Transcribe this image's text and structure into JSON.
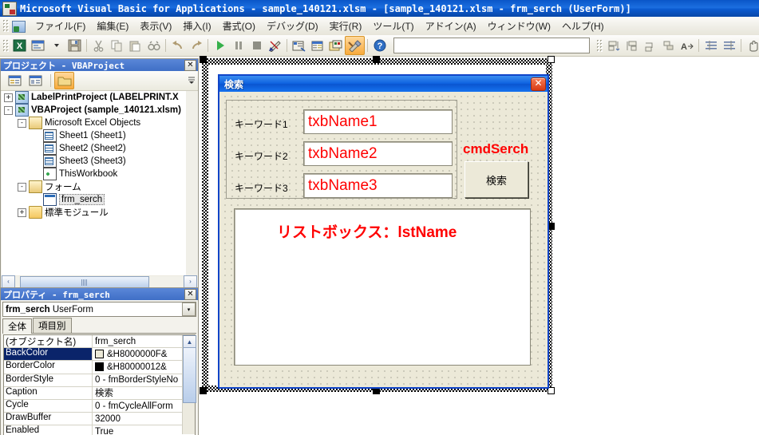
{
  "window": {
    "title": "Microsoft Visual Basic for Applications - sample_140121.xlsm - [sample_140121.xlsm - frm_serch (UserForm)]",
    "app_icon": "vba-icon"
  },
  "menu": {
    "items": [
      {
        "label": "ファイル(F)",
        "name": "menu-file"
      },
      {
        "label": "編集(E)",
        "name": "menu-edit"
      },
      {
        "label": "表示(V)",
        "name": "menu-view"
      },
      {
        "label": "挿入(I)",
        "name": "menu-insert"
      },
      {
        "label": "書式(O)",
        "name": "menu-format"
      },
      {
        "label": "デバッグ(D)",
        "name": "menu-debug"
      },
      {
        "label": "実行(R)",
        "name": "menu-run"
      },
      {
        "label": "ツール(T)",
        "name": "menu-tools"
      },
      {
        "label": "アドイン(A)",
        "name": "menu-addins"
      },
      {
        "label": "ウィンドウ(W)",
        "name": "menu-window"
      },
      {
        "label": "ヘルプ(H)",
        "name": "menu-help"
      }
    ]
  },
  "toolbar": {
    "buttons": [
      {
        "name": "view-excel-button",
        "glyph": "excel-icon",
        "selected": false
      },
      {
        "name": "insert-userform-button",
        "glyph": "userform-icon",
        "selected": false
      },
      {
        "name": "insert-dropdown-button",
        "glyph": "chevron-down-icon",
        "selected": false
      },
      {
        "name": "save-button",
        "glyph": "save-icon",
        "selected": false
      },
      {
        "name": "cut-button",
        "glyph": "scissors-icon",
        "selected": false
      },
      {
        "name": "copy-button",
        "glyph": "copy-icon",
        "selected": false
      },
      {
        "name": "paste-button",
        "glyph": "paste-icon",
        "selected": false
      },
      {
        "name": "find-button",
        "glyph": "binoculars-icon",
        "selected": false
      },
      {
        "name": "undo-button",
        "glyph": "undo-arrow-icon",
        "selected": false
      },
      {
        "name": "redo-button",
        "glyph": "redo-arrow-icon",
        "selected": false
      },
      {
        "name": "run-button",
        "glyph": "play-triangle-icon",
        "selected": false
      },
      {
        "name": "break-button",
        "glyph": "pause-icon",
        "selected": false
      },
      {
        "name": "reset-button",
        "glyph": "stop-square-icon",
        "selected": false
      },
      {
        "name": "design-mode-button",
        "glyph": "pencil-ruler-icon",
        "selected": false
      },
      {
        "name": "project-explorer-button",
        "glyph": "project-tree-icon",
        "selected": false
      },
      {
        "name": "properties-window-button",
        "glyph": "properties-icon",
        "selected": false
      },
      {
        "name": "object-browser-button",
        "glyph": "object-browser-icon",
        "selected": false
      },
      {
        "name": "toolbox-button",
        "glyph": "toolbox-hammer-icon",
        "selected": true
      },
      {
        "name": "help-button",
        "glyph": "question-mark-icon",
        "selected": false
      }
    ],
    "right_buttons": [
      {
        "name": "align-left-button",
        "glyph": "align-left-icon"
      },
      {
        "name": "align-right-button",
        "glyph": "align-right-icon"
      },
      {
        "name": "align-top-button",
        "glyph": "align-top-icon"
      },
      {
        "name": "align-bottom-button",
        "glyph": "align-bottom-icon"
      },
      {
        "name": "size-to-fit-button",
        "glyph": "size-text-icon"
      },
      {
        "name": "horizontal-spacing-button",
        "glyph": "hspacing-icon"
      },
      {
        "name": "vertical-spacing-button",
        "glyph": "vspacing-icon"
      },
      {
        "name": "group-button",
        "glyph": "hand-icon"
      },
      {
        "name": "order-front-button",
        "glyph": "order-front-icon"
      },
      {
        "name": "order-back-button",
        "glyph": "order-back-icon"
      }
    ]
  },
  "project_explorer": {
    "title": "プロジェクト - VBAProject",
    "close_label": "✕",
    "toolbar": [
      {
        "name": "view-code-button",
        "glyph": "view-code-icon",
        "selected": false
      },
      {
        "name": "view-object-button",
        "glyph": "view-object-icon",
        "selected": false
      },
      {
        "name": "toggle-folders-button",
        "glyph": "folder-icon",
        "selected": true
      }
    ],
    "tree": [
      {
        "label": "LabelPrintProject (LABELPRINT.X",
        "indent": 0,
        "expander": "+",
        "icon": "vba-project-icon",
        "bold": true,
        "selected": false
      },
      {
        "label": "VBAProject (sample_140121.xlsm)",
        "indent": 0,
        "expander": "-",
        "icon": "vba-project-icon",
        "bold": true,
        "selected": false
      },
      {
        "label": "Microsoft Excel Objects",
        "indent": 1,
        "expander": "-",
        "icon": "folder-open-icon",
        "bold": false,
        "selected": false
      },
      {
        "label": "Sheet1 (Sheet1)",
        "indent": 2,
        "expander": "",
        "icon": "sheet-icon",
        "bold": false,
        "selected": false
      },
      {
        "label": "Sheet2 (Sheet2)",
        "indent": 2,
        "expander": "",
        "icon": "sheet-icon",
        "bold": false,
        "selected": false
      },
      {
        "label": "Sheet3 (Sheet3)",
        "indent": 2,
        "expander": "",
        "icon": "sheet-icon",
        "bold": false,
        "selected": false
      },
      {
        "label": "ThisWorkbook",
        "indent": 2,
        "expander": "",
        "icon": "workbook-icon",
        "bold": false,
        "selected": false
      },
      {
        "label": "フォーム",
        "indent": 1,
        "expander": "-",
        "icon": "folder-open-icon",
        "bold": false,
        "selected": false
      },
      {
        "label": "frm_serch",
        "indent": 2,
        "expander": "",
        "icon": "userform-icon",
        "bold": false,
        "selected": true
      },
      {
        "label": "標準モジュール",
        "indent": 1,
        "expander": "+",
        "icon": "folder-icon",
        "bold": false,
        "selected": false
      }
    ],
    "hscroll": {
      "left_arrow": "‹",
      "right_arrow": "›"
    }
  },
  "properties": {
    "title": "プロパティ - frm_serch",
    "close_label": "✕",
    "object_name": "frm_serch",
    "object_type": "UserForm",
    "dropdown_arrow": "▾",
    "tabs": [
      {
        "label": "全体",
        "active": true,
        "name": "tab-alphabetic"
      },
      {
        "label": "項目別",
        "active": false,
        "name": "tab-categorized"
      }
    ],
    "rows": [
      {
        "name": "(オブジェクト名)",
        "value": "frm_serch",
        "selected": false,
        "swatch": null,
        "dropdown": false
      },
      {
        "name": "BackColor",
        "value": "&H8000000F&",
        "selected": true,
        "swatch": "#ece9d8",
        "dropdown": true
      },
      {
        "name": "BorderColor",
        "value": "&H80000012&",
        "selected": false,
        "swatch": "#000000",
        "dropdown": false
      },
      {
        "name": "BorderStyle",
        "value": "0 - fmBorderStyleNo",
        "selected": false,
        "swatch": null,
        "dropdown": false
      },
      {
        "name": "Caption",
        "value": "検索",
        "selected": false,
        "swatch": null,
        "dropdown": false
      },
      {
        "name": "Cycle",
        "value": "0 - fmCycleAllForm",
        "selected": false,
        "swatch": null,
        "dropdown": false
      },
      {
        "name": "DrawBuffer",
        "value": "32000",
        "selected": false,
        "swatch": null,
        "dropdown": false
      },
      {
        "name": "Enabled",
        "value": "True",
        "selected": false,
        "swatch": null,
        "dropdown": false
      }
    ],
    "scroll_up": "▲",
    "scroll_down": "▼"
  },
  "designer": {
    "form": {
      "caption": "検索",
      "close_label": "✕"
    },
    "frame": {
      "name": "keyword-frame"
    },
    "labels": [
      {
        "text": "キーワード1",
        "name": "label-keyword1"
      },
      {
        "text": "キーワード2",
        "name": "label-keyword2"
      },
      {
        "text": "キーワード3",
        "name": "label-keyword3"
      }
    ],
    "textboxes": [
      {
        "text": "txbName1",
        "name": "textbox-txbname1"
      },
      {
        "text": "txbName2",
        "name": "textbox-txbname2"
      },
      {
        "text": "txbName3",
        "name": "textbox-txbname3"
      }
    ],
    "command_label": "cmdSerch",
    "command_button": "検索",
    "listbox_caption": "リストボックス：lstName",
    "colors": {
      "annotation_red": "#ff0000",
      "form_face": "#ece9d8",
      "selection_blue": "#1145c8"
    }
  }
}
